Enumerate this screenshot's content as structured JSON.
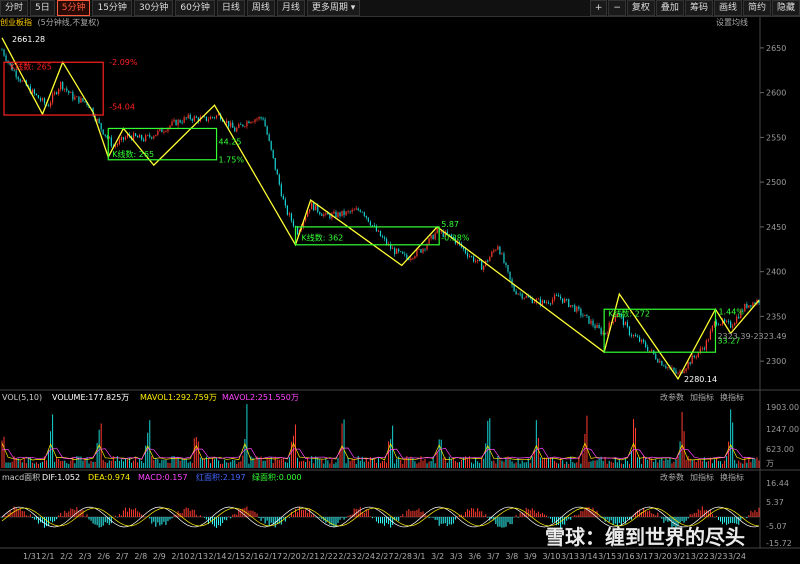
{
  "toolbar": {
    "periods": [
      "分时",
      "5日",
      "5分钟",
      "15分钟",
      "30分钟",
      "60分钟",
      "日线",
      "周线",
      "月线",
      "更多周期"
    ],
    "active_period": "5分钟",
    "right_items": [
      "+",
      "−",
      "复权",
      "叠加",
      "筹码",
      "画线",
      "简约",
      "隐藏"
    ]
  },
  "header": {
    "title": "创业板指",
    "subtitle": "(5分钟线,不复权)",
    "settings_label": "设置均线"
  },
  "colors": {
    "bg": "#000000",
    "up": "#ff3b30",
    "down": "#19d4d4",
    "zigzag": "#ffff33",
    "box_green": "#33ff33",
    "box_red": "#ff2020",
    "mavol1": "#ffee00",
    "mavol2": "#ff44ff"
  },
  "annotations": {
    "peak_label": "2661.28",
    "trough_label": "2280.14",
    "red_box": {
      "count_label": "K线数: 265",
      "pct_top": "-2.09%",
      "pct_bottom": "-54.04"
    },
    "box2": {
      "count_label": "K线数: 265",
      "pct_right": "44.25",
      "pct_below": "1.75%"
    },
    "box3": {
      "count_label": "K线数: 362",
      "pct_top": "5.87",
      "pct_mid": "-0.28%"
    },
    "box4": {
      "count_label": "K线数: 272",
      "pct_top": "1.44%",
      "pct_mid": "33.27",
      "range_label": "2323.39-2323.49"
    }
  },
  "volume_panel": {
    "label": "VOL(5,10)",
    "volume": "VOLUME:177.825万",
    "mavol1": "MAVOL1:292.759万",
    "mavol2": "MAVOL2:251.550万",
    "buttons": [
      "改参数",
      "加指标",
      "换指标"
    ],
    "axis": [
      "1903.00",
      "1247.00",
      "623.00",
      "万"
    ]
  },
  "macd_panel": {
    "label": "macd面积",
    "dif": "DIF:1.052",
    "dea": "DEA:0.974",
    "macd": "MACD:0.157",
    "red_area": "红面积:2.197",
    "green_area": "绿面积:0.000",
    "buttons": [
      "改参数",
      "加指标",
      "换指标"
    ],
    "axis": [
      "16.44",
      "5.37",
      "-5.07",
      "-15.72"
    ]
  },
  "watermark": "雪球：缠到世界的尽头",
  "chart_data": {
    "type": "candlestick",
    "ylim": [
      2270,
      2670
    ],
    "y_ticks": [
      2650,
      2600,
      2550,
      2500,
      2450,
      2400,
      2350,
      2300
    ],
    "x_labels": [
      "1/31",
      "2/1",
      "2/2",
      "2/3",
      "2/6",
      "2/7",
      "2/8",
      "2/9",
      "2/10",
      "2/13",
      "2/14",
      "2/15",
      "2/16",
      "2/17",
      "2/20",
      "2/21",
      "2/22",
      "2/23",
      "2/24",
      "2/27",
      "2/28",
      "3/1",
      "3/2",
      "3/3",
      "3/6",
      "3/7",
      "3/8",
      "3/9",
      "3/10",
      "3/13",
      "3/14",
      "3/15",
      "3/16",
      "3/17",
      "3/20",
      "3/21",
      "3/22",
      "3/23",
      "3/24"
    ],
    "zigzag": [
      {
        "i": 0,
        "v": 2661.28
      },
      {
        "i": 40,
        "v": 2576
      },
      {
        "i": 60,
        "v": 2634
      },
      {
        "i": 90,
        "v": 2578
      },
      {
        "i": 105,
        "v": 2528
      },
      {
        "i": 120,
        "v": 2560
      },
      {
        "i": 150,
        "v": 2519
      },
      {
        "i": 210,
        "v": 2586
      },
      {
        "i": 290,
        "v": 2430
      },
      {
        "i": 305,
        "v": 2480
      },
      {
        "i": 395,
        "v": 2407
      },
      {
        "i": 430,
        "v": 2450
      },
      {
        "i": 595,
        "v": 2310
      },
      {
        "i": 610,
        "v": 2375
      },
      {
        "i": 668,
        "v": 2280.14
      },
      {
        "i": 705,
        "v": 2358
      },
      {
        "i": 720,
        "v": 2331
      },
      {
        "i": 748,
        "v": 2368
      }
    ],
    "price_path": [
      {
        "i": 0,
        "v": 2648
      },
      {
        "i": 8,
        "v": 2630
      },
      {
        "i": 20,
        "v": 2612
      },
      {
        "i": 32,
        "v": 2598
      },
      {
        "i": 45,
        "v": 2585
      },
      {
        "i": 58,
        "v": 2610
      },
      {
        "i": 70,
        "v": 2595
      },
      {
        "i": 85,
        "v": 2588
      },
      {
        "i": 98,
        "v": 2560
      },
      {
        "i": 110,
        "v": 2540
      },
      {
        "i": 125,
        "v": 2552
      },
      {
        "i": 140,
        "v": 2548
      },
      {
        "i": 155,
        "v": 2556
      },
      {
        "i": 170,
        "v": 2566
      },
      {
        "i": 185,
        "v": 2572
      },
      {
        "i": 200,
        "v": 2570
      },
      {
        "i": 215,
        "v": 2575
      },
      {
        "i": 230,
        "v": 2558
      },
      {
        "i": 245,
        "v": 2570
      },
      {
        "i": 258,
        "v": 2572
      },
      {
        "i": 268,
        "v": 2525
      },
      {
        "i": 280,
        "v": 2470
      },
      {
        "i": 292,
        "v": 2445
      },
      {
        "i": 305,
        "v": 2475
      },
      {
        "i": 320,
        "v": 2462
      },
      {
        "i": 340,
        "v": 2465
      },
      {
        "i": 355,
        "v": 2470
      },
      {
        "i": 370,
        "v": 2445
      },
      {
        "i": 385,
        "v": 2425
      },
      {
        "i": 400,
        "v": 2415
      },
      {
        "i": 415,
        "v": 2425
      },
      {
        "i": 430,
        "v": 2445
      },
      {
        "i": 445,
        "v": 2438
      },
      {
        "i": 460,
        "v": 2420
      },
      {
        "i": 475,
        "v": 2405
      },
      {
        "i": 490,
        "v": 2430
      },
      {
        "i": 505,
        "v": 2380
      },
      {
        "i": 520,
        "v": 2370
      },
      {
        "i": 535,
        "v": 2365
      },
      {
        "i": 550,
        "v": 2372
      },
      {
        "i": 565,
        "v": 2360
      },
      {
        "i": 580,
        "v": 2345
      },
      {
        "i": 595,
        "v": 2330
      },
      {
        "i": 608,
        "v": 2355
      },
      {
        "i": 620,
        "v": 2332
      },
      {
        "i": 635,
        "v": 2318
      },
      {
        "i": 650,
        "v": 2300
      },
      {
        "i": 668,
        "v": 2285
      },
      {
        "i": 680,
        "v": 2300
      },
      {
        "i": 695,
        "v": 2318
      },
      {
        "i": 705,
        "v": 2345
      },
      {
        "i": 720,
        "v": 2340
      },
      {
        "i": 735,
        "v": 2362
      },
      {
        "i": 748,
        "v": 2368
      }
    ],
    "n_bars": 750
  }
}
